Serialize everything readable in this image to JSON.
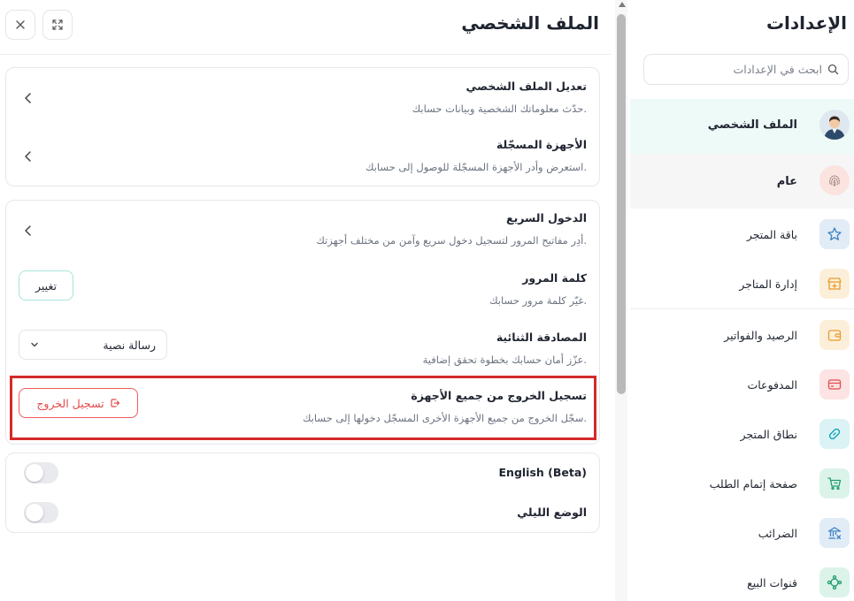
{
  "main": {
    "title": "الملف الشخصي",
    "close_icon": "close-icon",
    "expand_icon": "expand-icon",
    "card1": {
      "rows": [
        {
          "title": "تعديل الملف الشخصي",
          "desc": "حدّث معلوماتك الشخصية وبيانات حسابك."
        },
        {
          "title": "الأجهزة المسجّلة",
          "desc": "استعرض وأدر الأجهزة المسجّلة للوصول إلى حسابك."
        }
      ]
    },
    "card2": {
      "quick_login": {
        "title": "الدخول السريع",
        "desc": "أدِر مفاتيح المرور لتسجيل دخول سريع وآمن من مختلف أجهزتك."
      },
      "password": {
        "title": "كلمة المرور",
        "desc": "غيّر كلمة مرور حسابك.",
        "button": "تغيير"
      },
      "two_factor": {
        "title": "المصادقة الثنائية",
        "desc": "عزّز أمان حسابك بخطوة تحقق إضافية.",
        "selected": "رسالة نصية"
      },
      "logout_all": {
        "title": "تسجيل الخروج من جميع الأجهزة",
        "desc": "سجّل الخروج من جميع الأجهزة الأخرى المسجّل دخولها إلى حسابك.",
        "button": "تسجيل الخروج"
      }
    },
    "card3": {
      "english": {
        "label": "English (Beta)",
        "on": false
      },
      "dark_mode": {
        "label": "الوضع الليلي",
        "on": false
      }
    }
  },
  "sidebar": {
    "title": "الإعدادات",
    "search_placeholder": "ابحث في الإعدادات",
    "items": [
      {
        "label": "الملف الشخصي",
        "icon": "avatar-icon",
        "active": true
      },
      {
        "label": "عام",
        "icon": "fingerprint-icon"
      },
      {
        "label": "باقة المتجر",
        "icon": "star-icon",
        "color": "#3b82c4"
      },
      {
        "label": "إدارة المتاجر",
        "icon": "store-icon",
        "color": "#e89a2c"
      },
      {
        "label": "الرصيد والفواتير",
        "icon": "wallet-icon",
        "color": "#e89a2c"
      },
      {
        "label": "المدفوعات",
        "icon": "card-icon",
        "color": "#e14b4b"
      },
      {
        "label": "نطاق المتجر",
        "icon": "link-icon",
        "color": "#14a3b8"
      },
      {
        "label": "صفحة إتمام الطلب",
        "icon": "cart-icon",
        "color": "#1f9d6b"
      },
      {
        "label": "الضرائب",
        "icon": "bank-icon",
        "color": "#3b82c4"
      },
      {
        "label": "قنوات البيع",
        "icon": "channels-icon",
        "color": "#1f9d6b"
      }
    ]
  },
  "colors": {
    "accent": "#2bb39a",
    "danger": "#e14b4b",
    "highlight_border": "#d42a2a"
  }
}
